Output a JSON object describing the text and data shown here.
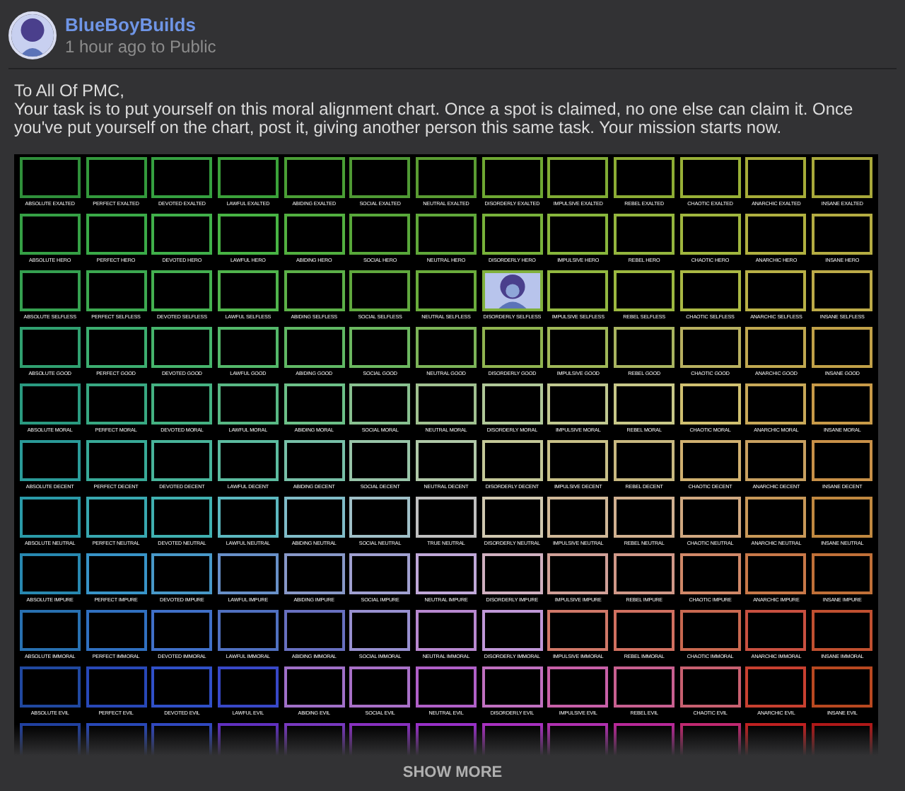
{
  "post": {
    "author": "BlueBoyBuilds",
    "meta": "1 hour ago to Public"
  },
  "message": {
    "greeting": "To All Of PMC,",
    "body": "Your task is to put yourself on this moral alignment chart. Once a spot is claimed, no one else can claim it. Once you've put yourself on the chart, post it, giving another person this same task. Your mission starts now."
  },
  "chart": {
    "rows": [
      {
        "cells": [
          {
            "label": "ABSOLUTE EXALTED",
            "color": "#2f8f3a",
            "claimed": false
          },
          {
            "label": "PERFECT EXALTED",
            "color": "#339a3c",
            "claimed": false
          },
          {
            "label": "DEVOTED EXALTED",
            "color": "#35a040",
            "claimed": false
          },
          {
            "label": "LAWFUL EXALTED",
            "color": "#3ba23a",
            "claimed": false
          },
          {
            "label": "ABIDING EXALTED",
            "color": "#4a9f35",
            "claimed": false
          },
          {
            "label": "SOCIAL EXALTED",
            "color": "#4f9a34",
            "claimed": false
          },
          {
            "label": "NEUTRAL EXALTED",
            "color": "#5a9c32",
            "claimed": false
          },
          {
            "label": "DISORDERLY EXALTED",
            "color": "#6ea832",
            "claimed": false
          },
          {
            "label": "IMPULSIVE EXALTED",
            "color": "#80ac34",
            "claimed": false
          },
          {
            "label": "REBEL EXALTED",
            "color": "#8cac34",
            "claimed": false
          },
          {
            "label": "CHAOTIC EXALTED",
            "color": "#98b036",
            "claimed": false
          },
          {
            "label": "ANARCHIC EXALTED",
            "color": "#a6ac38",
            "claimed": false
          },
          {
            "label": "INSANE EXALTED",
            "color": "#a8a83a",
            "claimed": false
          }
        ]
      },
      {
        "cells": [
          {
            "label": "ABSOLUTE HERO",
            "color": "#35a045",
            "claimed": false
          },
          {
            "label": "PERFECT HERO",
            "color": "#3aaa48",
            "claimed": false
          },
          {
            "label": "DEVOTED HERO",
            "color": "#40b04a",
            "claimed": false
          },
          {
            "label": "LAWFUL HERO",
            "color": "#48b444",
            "claimed": false
          },
          {
            "label": "ABIDING HERO",
            "color": "#52b040",
            "claimed": false
          },
          {
            "label": "SOCIAL HERO",
            "color": "#58a83a",
            "claimed": false
          },
          {
            "label": "NEUTRAL HERO",
            "color": "#60a83a",
            "claimed": false
          },
          {
            "label": "DISORDERLY HERO",
            "color": "#78b23a",
            "claimed": false
          },
          {
            "label": "IMPULSIVE HERO",
            "color": "#88b63c",
            "claimed": false
          },
          {
            "label": "REBEL HERO",
            "color": "#94b63e",
            "claimed": false
          },
          {
            "label": "CHAOTIC HERO",
            "color": "#a0b63e",
            "claimed": false
          },
          {
            "label": "ANARCHIC HERO",
            "color": "#b0b040",
            "claimed": false
          },
          {
            "label": "INSANE HERO",
            "color": "#b4ac42",
            "claimed": false
          }
        ]
      },
      {
        "cells": [
          {
            "label": "ABSOLUTE SELFLESS",
            "color": "#35a050",
            "claimed": false
          },
          {
            "label": "PERFECT SELFLESS",
            "color": "#3ca850",
            "claimed": false
          },
          {
            "label": "DEVOTED SELFLESS",
            "color": "#44b050",
            "claimed": false
          },
          {
            "label": "LAWFUL SELFLESS",
            "color": "#50b44c",
            "claimed": false
          },
          {
            "label": "ABIDING SELFLESS",
            "color": "#5cb048",
            "claimed": false
          },
          {
            "label": "SOCIAL SELFLESS",
            "color": "#60a83e",
            "claimed": false
          },
          {
            "label": "NEUTRAL SELFLESS",
            "color": "#6aac3c",
            "claimed": false
          },
          {
            "label": "DISORDERLY SELFLESS",
            "color": "#80b03c",
            "claimed": true
          },
          {
            "label": "IMPULSIVE SELFLESS",
            "color": "#92b840",
            "claimed": false
          },
          {
            "label": "REBEL SELFLESS",
            "color": "#9cb840",
            "claimed": false
          },
          {
            "label": "CHAOTIC SELFLESS",
            "color": "#aab844",
            "claimed": false
          },
          {
            "label": "ANARCHIC SELFLESS",
            "color": "#b8b046",
            "claimed": false
          },
          {
            "label": "INSANE SELFLESS",
            "color": "#bcaa48",
            "claimed": false
          }
        ]
      },
      {
        "cells": [
          {
            "label": "ABSOLUTE GOOD",
            "color": "#30a070",
            "claimed": false
          },
          {
            "label": "PERFECT GOOD",
            "color": "#3cae70",
            "claimed": false
          },
          {
            "label": "DEVOTED GOOD",
            "color": "#46b46c",
            "claimed": false
          },
          {
            "label": "LAWFUL GOOD",
            "color": "#54b86a",
            "claimed": false
          },
          {
            "label": "ABIDING GOOD",
            "color": "#60b864",
            "claimed": false
          },
          {
            "label": "SOCIAL GOOD",
            "color": "#6cb860",
            "claimed": false
          },
          {
            "label": "NEUTRAL GOOD",
            "color": "#7cb458",
            "claimed": false
          },
          {
            "label": "DISORDERLY GOOD",
            "color": "#90b450",
            "claimed": false
          },
          {
            "label": "IMPULSIVE GOOD",
            "color": "#a0b858",
            "claimed": false
          },
          {
            "label": "REBEL GOOD",
            "color": "#a8b460",
            "claimed": false
          },
          {
            "label": "CHAOTIC GOOD",
            "color": "#b8b060",
            "claimed": false
          },
          {
            "label": "ANARCHIC GOOD",
            "color": "#c0a850",
            "claimed": false
          },
          {
            "label": "INSANE GOOD",
            "color": "#c0a048",
            "claimed": false
          }
        ]
      },
      {
        "cells": [
          {
            "label": "ABSOLUTE MORAL",
            "color": "#2a9a80",
            "claimed": false
          },
          {
            "label": "PERFECT MORAL",
            "color": "#38a882",
            "claimed": false
          },
          {
            "label": "DEVOTED MORAL",
            "color": "#44b282",
            "claimed": false
          },
          {
            "label": "LAWFUL MORAL",
            "color": "#58b884",
            "claimed": false
          },
          {
            "label": "ABIDING MORAL",
            "color": "#6cc088",
            "claimed": false
          },
          {
            "label": "SOCIAL MORAL",
            "color": "#88c090",
            "claimed": false
          },
          {
            "label": "NEUTRAL MORAL",
            "color": "#a0c090",
            "claimed": false
          },
          {
            "label": "DISORDERLY MORAL",
            "color": "#b0c898",
            "claimed": false
          },
          {
            "label": "IMPULSIVE MORAL",
            "color": "#c0c890",
            "claimed": false
          },
          {
            "label": "REBEL MORAL",
            "color": "#c8c888",
            "claimed": false
          },
          {
            "label": "CHAOTIC MORAL",
            "color": "#d0c070",
            "claimed": false
          },
          {
            "label": "ANARCHIC MORAL",
            "color": "#c8a858",
            "claimed": false
          },
          {
            "label": "INSANE MORAL",
            "color": "#c89a48",
            "claimed": false
          }
        ]
      },
      {
        "cells": [
          {
            "label": "ABSOLUTE DECENT",
            "color": "#2a9a98",
            "claimed": false
          },
          {
            "label": "PERFECT DECENT",
            "color": "#38aa98",
            "claimed": false
          },
          {
            "label": "DEVOTED DECENT",
            "color": "#48b49a",
            "claimed": false
          },
          {
            "label": "LAWFUL DECENT",
            "color": "#5cbca0",
            "claimed": false
          },
          {
            "label": "ABIDING DECENT",
            "color": "#78c0a8",
            "claimed": false
          },
          {
            "label": "SOCIAL DECENT",
            "color": "#98c4a8",
            "claimed": false
          },
          {
            "label": "NEUTRAL DECENT",
            "color": "#b0c8a8",
            "claimed": false
          },
          {
            "label": "DISORDERLY DECENT",
            "color": "#c4c898",
            "claimed": false
          },
          {
            "label": "IMPULSIVE DECENT",
            "color": "#c8c088",
            "claimed": false
          },
          {
            "label": "REBEL DECENT",
            "color": "#c8b880",
            "claimed": false
          },
          {
            "label": "CHAOTIC DECENT",
            "color": "#d0b070",
            "claimed": false
          },
          {
            "label": "ANARCHIC DECENT",
            "color": "#c8a060",
            "claimed": false
          },
          {
            "label": "INSANE DECENT",
            "color": "#c89048",
            "claimed": false
          }
        ]
      },
      {
        "cells": [
          {
            "label": "ABSOLUTE NEUTRAL",
            "color": "#2a9aa8",
            "claimed": false
          },
          {
            "label": "PERFECT NEUTRAL",
            "color": "#38a8b0",
            "claimed": false
          },
          {
            "label": "DEVOTED NEUTRAL",
            "color": "#40b0b0",
            "claimed": false
          },
          {
            "label": "LAWFUL NEUTRAL",
            "color": "#5cb8c0",
            "claimed": false
          },
          {
            "label": "ABIDING NEUTRAL",
            "color": "#80bcc8",
            "claimed": false
          },
          {
            "label": "SOCIAL NEUTRAL",
            "color": "#a0c0c8",
            "claimed": false
          },
          {
            "label": "TRUE NEUTRAL",
            "color": "#c0c0c0",
            "claimed": false
          },
          {
            "label": "DISORDERLY NEUTRAL",
            "color": "#d0c8b0",
            "claimed": false
          },
          {
            "label": "IMPULSIVE NEUTRAL",
            "color": "#d0b898",
            "claimed": false
          },
          {
            "label": "REBEL NEUTRAL",
            "color": "#d0b090",
            "claimed": false
          },
          {
            "label": "CHAOTIC NEUTRAL",
            "color": "#d0a880",
            "claimed": false
          },
          {
            "label": "ANARCHIC NEUTRAL",
            "color": "#c89858",
            "claimed": false
          },
          {
            "label": "INSANE NEUTRAL",
            "color": "#c08840",
            "claimed": false
          }
        ]
      },
      {
        "cells": [
          {
            "label": "ABSOLUTE IMPURE",
            "color": "#2888b0",
            "claimed": false
          },
          {
            "label": "PERFECT IMPURE",
            "color": "#3894c8",
            "claimed": false
          },
          {
            "label": "DEVOTED IMPURE",
            "color": "#4898c8",
            "claimed": false
          },
          {
            "label": "LAWFUL IMPURE",
            "color": "#6890c8",
            "claimed": false
          },
          {
            "label": "ABIDING IMPURE",
            "color": "#8898c8",
            "claimed": false
          },
          {
            "label": "SOCIAL IMPURE",
            "color": "#a0a0d0",
            "claimed": false
          },
          {
            "label": "NEUTRAL IMPURE",
            "color": "#c0a8d8",
            "claimed": false
          },
          {
            "label": "DISORDERLY IMPURE",
            "color": "#d0b0c0",
            "claimed": false
          },
          {
            "label": "IMPULSIVE IMPURE",
            "color": "#d0a098",
            "claimed": false
          },
          {
            "label": "REBEL IMPURE",
            "color": "#d09888",
            "claimed": false
          },
          {
            "label": "CHAOTIC IMPURE",
            "color": "#d08868",
            "claimed": false
          },
          {
            "label": "ANARCHIC IMPURE",
            "color": "#c87848",
            "claimed": false
          },
          {
            "label": "INSANE IMPURE",
            "color": "#c07038",
            "claimed": false
          }
        ]
      },
      {
        "cells": [
          {
            "label": "ABSOLUTE IMMORAL",
            "color": "#2870b0",
            "claimed": false
          },
          {
            "label": "PERFECT IMMORAL",
            "color": "#3070c0",
            "claimed": false
          },
          {
            "label": "DEVOTED IMMORAL",
            "color": "#4070c8",
            "claimed": false
          },
          {
            "label": "LAWFUL IMMORAL",
            "color": "#5070c0",
            "claimed": false
          },
          {
            "label": "ABIDING IMMORAL",
            "color": "#6870c0",
            "claimed": false
          },
          {
            "label": "SOCIAL IMMORAL",
            "color": "#9890d0",
            "claimed": false
          },
          {
            "label": "NEUTRAL IMMORAL",
            "color": "#b888d0",
            "claimed": false
          },
          {
            "label": "DISORDERLY IMMORAL",
            "color": "#c098d8",
            "claimed": false
          },
          {
            "label": "IMPULSIVE IMMORAL",
            "color": "#d07868",
            "claimed": false
          },
          {
            "label": "REBEL IMMORAL",
            "color": "#d07060",
            "claimed": false
          },
          {
            "label": "CHAOTIC IMMORAL",
            "color": "#c86850",
            "claimed": false
          },
          {
            "label": "ANARCHIC IMMORAL",
            "color": "#c85040",
            "claimed": false
          },
          {
            "label": "INSANE IMMORAL",
            "color": "#c05030",
            "claimed": false
          }
        ]
      },
      {
        "cells": [
          {
            "label": "ABSOLUTE EVIL",
            "color": "#2048a0",
            "claimed": false
          },
          {
            "label": "PERFECT EVIL",
            "color": "#2848b8",
            "claimed": false
          },
          {
            "label": "DEVOTED EVIL",
            "color": "#3050c8",
            "claimed": false
          },
          {
            "label": "LAWFUL EVIL",
            "color": "#3848c8",
            "claimed": false
          },
          {
            "label": "ABIDING EVIL",
            "color": "#a070c8",
            "claimed": false
          },
          {
            "label": "SOCIAL EVIL",
            "color": "#a870c8",
            "claimed": false
          },
          {
            "label": "NEUTRAL EVIL",
            "color": "#b060c8",
            "claimed": false
          },
          {
            "label": "DISORDERLY EVIL",
            "color": "#c070c0",
            "claimed": false
          },
          {
            "label": "IMPULSIVE EVIL",
            "color": "#c860a8",
            "claimed": false
          },
          {
            "label": "REBEL EVIL",
            "color": "#c86090",
            "claimed": false
          },
          {
            "label": "CHAOTIC EVIL",
            "color": "#c86070",
            "claimed": false
          },
          {
            "label": "ANARCHIC EVIL",
            "color": "#c84030",
            "claimed": false
          },
          {
            "label": "INSANE EVIL",
            "color": "#b84820",
            "claimed": false
          }
        ]
      },
      {
        "cells": [
          {
            "color": "#2040a0",
            "claimed": false
          },
          {
            "color": "#2848b8",
            "claimed": false
          },
          {
            "color": "#3048c0",
            "claimed": false
          },
          {
            "color": "#6030c0",
            "claimed": false
          },
          {
            "color": "#7838c0",
            "claimed": false
          },
          {
            "color": "#8830c0",
            "claimed": false
          },
          {
            "color": "#9830c8",
            "claimed": false
          },
          {
            "color": "#a830c0",
            "claimed": false
          },
          {
            "color": "#b030b0",
            "claimed": false
          },
          {
            "color": "#b82898",
            "claimed": false
          },
          {
            "color": "#c02870",
            "claimed": false
          },
          {
            "color": "#c02020",
            "claimed": false
          },
          {
            "color": "#b01818",
            "claimed": false
          }
        ]
      }
    ]
  },
  "show_more": "SHOW MORE"
}
